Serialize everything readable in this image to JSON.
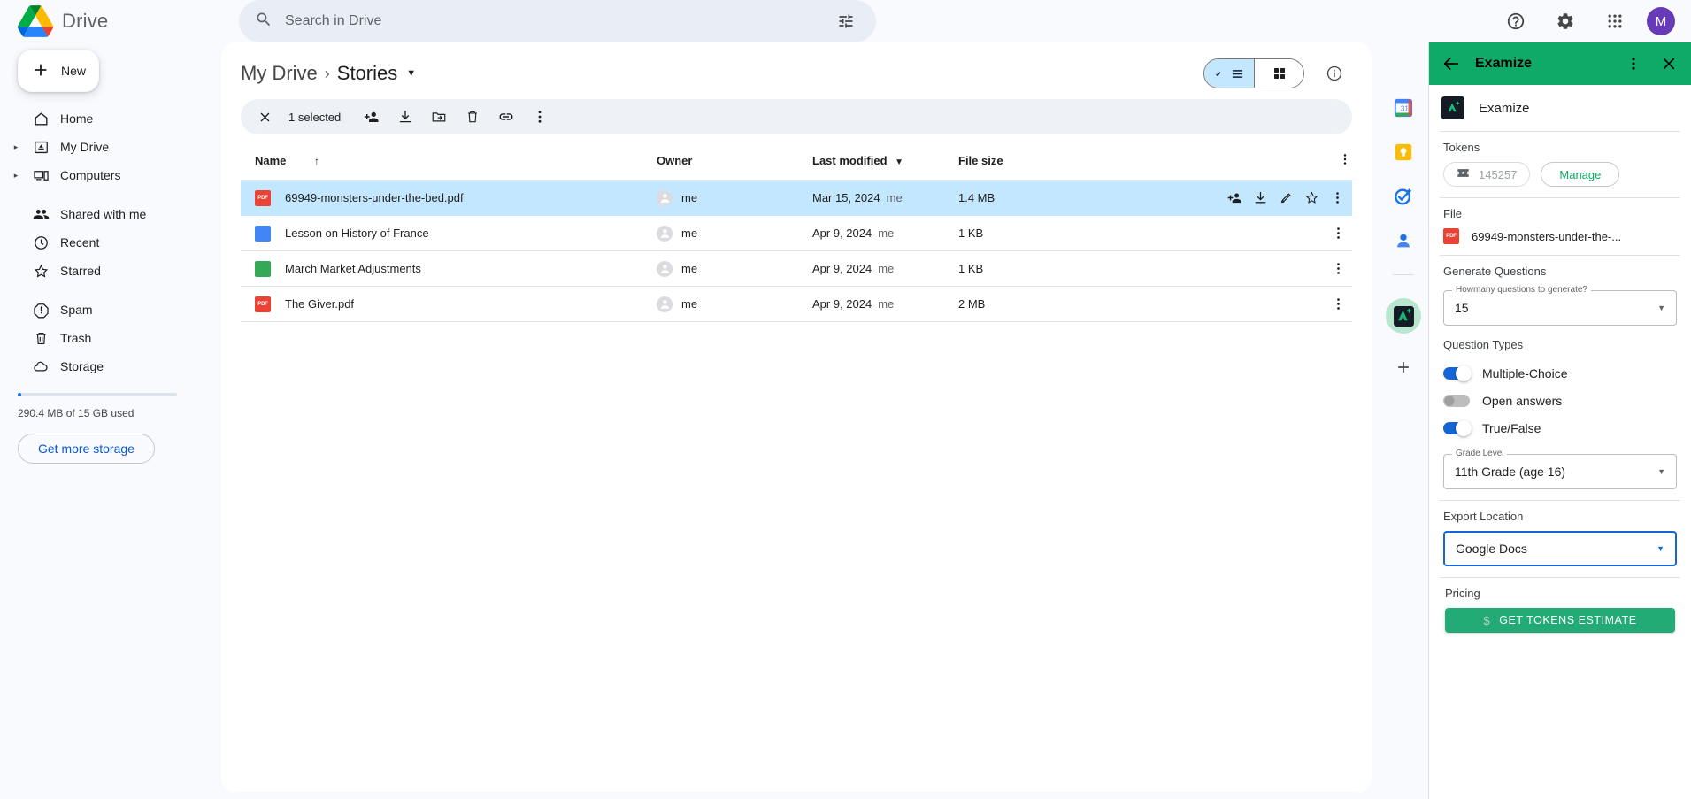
{
  "topbar": {
    "brand_name": "Drive",
    "search": {
      "placeholder": "Search in Drive",
      "value": ""
    },
    "help_title": "Support",
    "settings_title": "Settings",
    "apps_title": "Google apps",
    "avatar_initial": "M"
  },
  "sidebar": {
    "new_label": "New",
    "items": [
      {
        "label": "Home",
        "icon": "home-icon",
        "expandable": false
      },
      {
        "label": "My Drive",
        "icon": "my-drive-icon",
        "expandable": true
      },
      {
        "label": "Computers",
        "icon": "computers-icon",
        "expandable": true
      },
      {
        "label": "Shared with me",
        "icon": "shared-icon",
        "expandable": false
      },
      {
        "label": "Recent",
        "icon": "clock-icon",
        "expandable": false
      },
      {
        "label": "Starred",
        "icon": "star-icon",
        "expandable": false
      },
      {
        "label": "Spam",
        "icon": "spam-icon",
        "expandable": false
      },
      {
        "label": "Trash",
        "icon": "trash-icon",
        "expandable": false
      },
      {
        "label": "Storage",
        "icon": "cloud-icon",
        "expandable": false
      }
    ],
    "storage": {
      "used_text": "290.4 MB of 15 GB used",
      "percent": 2,
      "button_label": "Get more storage"
    }
  },
  "main": {
    "breadcrumb": {
      "root": "My Drive",
      "separator": "›",
      "current": "Stories"
    },
    "view_toggle": {
      "list_active": true,
      "grid_active": false
    },
    "info_title": "View details",
    "selection": {
      "count_label": "1 selected",
      "actions": [
        "share-icon",
        "download-icon",
        "move-to-folder-icon",
        "trash-icon",
        "link-icon",
        "more-icon"
      ]
    },
    "table": {
      "columns": [
        "Name",
        "Owner",
        "Last modified",
        "File size"
      ],
      "sort_column": "Name",
      "sort_direction": "ascending",
      "rows": [
        {
          "name": "69949-monsters-under-the-bed.pdf",
          "type": "pdf",
          "type_label": "PDF",
          "owner": "me",
          "modified": "Mar 15, 2024",
          "modified_by": "me",
          "size": "1.4 MB",
          "selected": true
        },
        {
          "name": "Lesson on History of France",
          "type": "doc",
          "type_label": "",
          "owner": "me",
          "modified": "Apr 9, 2024",
          "modified_by": "me",
          "size": "1 KB",
          "selected": false
        },
        {
          "name": "March Market Adjustments",
          "type": "sheet",
          "type_label": "",
          "owner": "me",
          "modified": "Apr 9, 2024",
          "modified_by": "me",
          "size": "1 KB",
          "selected": false
        },
        {
          "name": "The Giver.pdf",
          "type": "pdf",
          "type_label": "PDF",
          "owner": "me",
          "modified": "Apr 9, 2024",
          "modified_by": "me",
          "size": "2 MB",
          "selected": false
        }
      ]
    },
    "row_actions": [
      "share-icon",
      "download-icon",
      "edit-icon",
      "star-icon",
      "more-icon"
    ]
  },
  "app_strip": {
    "apps": [
      {
        "name": "calendar-app-icon",
        "label": "Calendar"
      },
      {
        "name": "keep-app-icon",
        "label": "Keep"
      },
      {
        "name": "tasks-app-icon",
        "label": "Tasks"
      },
      {
        "name": "contacts-app-icon",
        "label": "Contacts"
      }
    ],
    "active_app": {
      "name": "examize-app-icon",
      "label": "Examize"
    },
    "add_label": "Get add-ons"
  },
  "examize": {
    "header": {
      "title": "Examize",
      "back_icon": "back-arrow-icon",
      "more_icon": "more-vert-icon",
      "close_icon": "close-icon"
    },
    "app_name": "Examize",
    "tokens": {
      "label": "Tokens",
      "count": "145257",
      "manage_label": "Manage"
    },
    "file": {
      "label": "File",
      "name": "69949-monsters-under-the-...",
      "type_label": "PDF"
    },
    "generate": {
      "section_label": "Generate Questions",
      "count_field_label": "Howmany questions to generate?",
      "count_value": "15"
    },
    "question_types": {
      "section_label": "Question Types",
      "items": [
        {
          "label": "Multiple-Choice",
          "enabled": true
        },
        {
          "label": "Open answers",
          "enabled": false
        },
        {
          "label": "True/False",
          "enabled": true
        }
      ]
    },
    "grade": {
      "field_label": "Grade Level",
      "value": "11th Grade (age 16)"
    },
    "export": {
      "label": "Export Location",
      "value": "Google Docs",
      "focused": true
    },
    "pricing": {
      "label": "Pricing",
      "button_label": "GET TOKENS ESTIMATE"
    },
    "colors": {
      "header_green": "#0fa968",
      "button_green": "#22ab74",
      "focus_blue": "#1565d8"
    }
  }
}
